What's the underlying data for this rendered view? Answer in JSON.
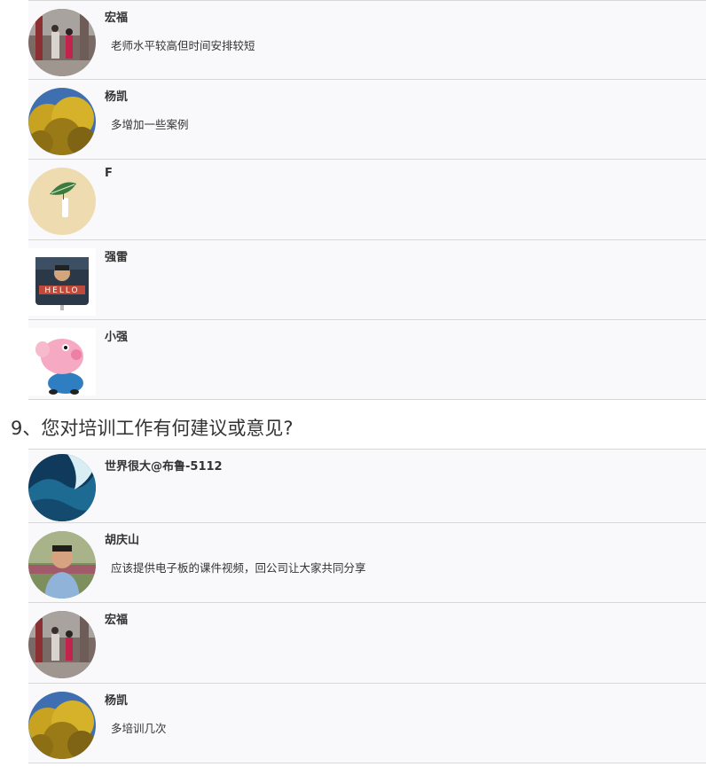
{
  "section_a": {
    "responses": [
      {
        "name": "宏福",
        "comment": "老师水平较高但时间安排较短",
        "avatar": "people-garden-avatar"
      },
      {
        "name": "杨凯",
        "comment": "多增加一些案例",
        "avatar": "yellow-tree-avatar"
      },
      {
        "name": "F",
        "comment": "",
        "avatar": "leaf-plant-avatar"
      },
      {
        "name": "强雷",
        "comment": "",
        "avatar": "hello-sign-avatar"
      },
      {
        "name": "小强",
        "comment": "",
        "avatar": "pink-pig-cartoon-avatar"
      }
    ]
  },
  "question9": {
    "text": "9、您对培训工作有何建议或意见?"
  },
  "section_b": {
    "responses": [
      {
        "name": "世界很大@布鲁-5112",
        "comment": "",
        "avatar": "ocean-wave-avatar"
      },
      {
        "name": "胡庆山",
        "comment": "应该提供电子板的课件视频，回公司让大家共同分享",
        "avatar": "man-portrait-avatar"
      },
      {
        "name": "宏福",
        "comment": "",
        "avatar": "people-garden-avatar"
      },
      {
        "name": "杨凯",
        "comment": "多培训几次",
        "avatar": "yellow-tree-avatar"
      }
    ]
  },
  "colors": {
    "row_background": "#f9f9fb",
    "divider": "#d8d8d8",
    "text": "#333333"
  }
}
